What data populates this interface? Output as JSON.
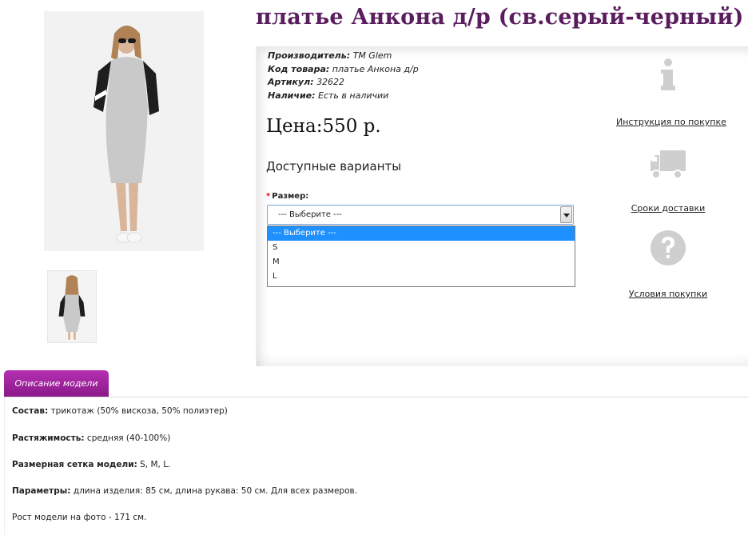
{
  "product": {
    "title": "платье Анкона д/р (св.серый-черный)",
    "manufacturer_label": "Производитель:",
    "manufacturer": "TM Glem",
    "code_label": "Код товара:",
    "code": "платье Анкона д/р",
    "sku_label": "Артикул:",
    "sku": "32622",
    "stock_label": "Наличие:",
    "stock": "Есть в наличии",
    "price": "Цена:550 р."
  },
  "variants": {
    "heading": "Доступные варианты",
    "size_required_mark": "*",
    "size_label": "Размер:",
    "selected": "--- Выберите ---",
    "options": [
      "--- Выберите ---",
      "S",
      "M",
      "L"
    ]
  },
  "side_links": [
    {
      "label": "Инструкция по покупке",
      "icon": "info-icon"
    },
    {
      "label": "Сроки доставки",
      "icon": "truck-icon"
    },
    {
      "label": "Условия покупки",
      "icon": "question-icon"
    }
  ],
  "description": {
    "tab_label": "Описание модели",
    "lines": [
      {
        "label": "Состав:",
        "text": " трикотаж (50% вискоза, 50% полиэтер)"
      },
      {
        "label": "Растяжимость:",
        "text": " средняя (40-100%)"
      },
      {
        "label": "Размерная сетка модели:",
        "text": " S, M, L."
      },
      {
        "label": "Параметры:",
        "text": " длина изделия: 85 см, длина рукава: 50 см. Для всех размеров."
      },
      {
        "label": "",
        "text": "Рост модели на фото - 171 см."
      }
    ]
  },
  "colors": {
    "title": "#5a1d5e",
    "tab": "#9b229a",
    "dropdown_highlight": "#1e90ff",
    "icon_gray": "#cfcfcf"
  }
}
